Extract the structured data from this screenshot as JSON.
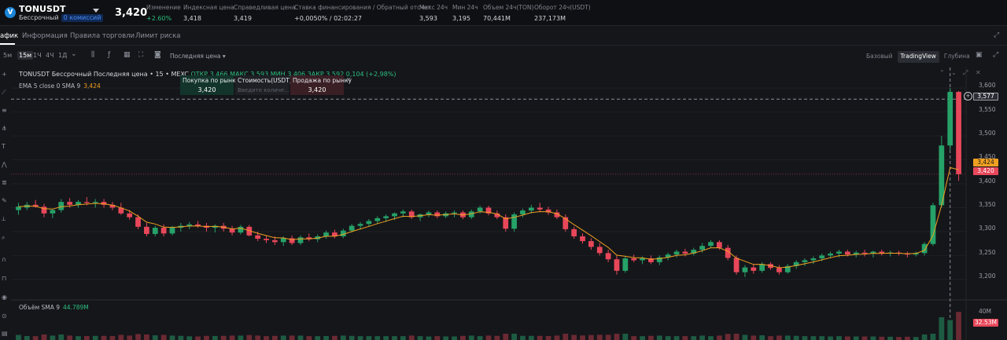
{
  "header": {
    "logo_letter": "V",
    "symbol": "TONUSDT",
    "contract_type": "Бессрочный",
    "fee_badge": "0 комиссий",
    "last_price": "3,420",
    "stats": [
      {
        "label": "Изменение",
        "value": "+2.60%",
        "positive": true
      },
      {
        "label": "Индексная цена",
        "value": "3,418"
      },
      {
        "label": "Справедливая цена",
        "value": "3,419"
      },
      {
        "label": "Ставка финансирования / Обратный отсчет",
        "value": "+0,0050% / 02:02:27"
      },
      {
        "label": "Макс 24ч",
        "value": "3,593"
      },
      {
        "label": "Мин 24ч",
        "value": "3,195"
      },
      {
        "label": "Объем 24ч(TON)",
        "value": "70,441M"
      },
      {
        "label": "Оборот 24ч(USDT)",
        "value": "237,173M"
      }
    ]
  },
  "tabs": [
    {
      "label": "афик",
      "active": true
    },
    {
      "label": "Информация",
      "active": false
    },
    {
      "label": "Правила торговли",
      "active": false
    },
    {
      "label": "Лимит риска",
      "active": false
    }
  ],
  "toolbar": {
    "timeframes": [
      {
        "label": "5м",
        "active": false
      },
      {
        "label": "15м",
        "active": true
      },
      {
        "label": "1Ч",
        "active": false
      },
      {
        "label": "4Ч",
        "active": false
      },
      {
        "label": "1Д",
        "active": false
      }
    ],
    "price_type": "Последняя цена",
    "views": [
      {
        "label": "Базовый",
        "active": false
      },
      {
        "label": "TradingView",
        "active": true
      },
      {
        "label": "Глубина",
        "active": false
      }
    ]
  },
  "legend": {
    "title": "TONUSDT Бессрочный Последняя цена • 15 • MEXC",
    "ohlc": "ОТКР 3,466 МАКС 3,593 МИН 3,406 ЗАКР 3,592 0,104 (+2,98%)",
    "ema_label": "EMA 5 close 0 SMA 9",
    "ema_value": "3,424",
    "volume_label": "Объём SMA 9",
    "volume_value": "44.789M"
  },
  "order_panel": {
    "buy_label": "Покупка по рынку",
    "buy_value": "3,420",
    "cost_label": "Стоимость(USDT)",
    "cost_placeholder": "Введите количе...",
    "sell_label": "Продажа по рынку",
    "sell_value": "3,420"
  },
  "price_axis": {
    "ticks": [
      "3,600",
      "3,550",
      "3,500",
      "3,450",
      "3,400",
      "3,350",
      "3,300",
      "3,250",
      "3,200"
    ],
    "crosshair_price": "3,577",
    "ema_tag": "3,424",
    "last_tag": "3,420",
    "volume_ticks": [
      "40M"
    ],
    "volume_tag": "32.53M"
  },
  "colors": {
    "up": "#26a269",
    "down": "#e8475a",
    "ema": "#f0a020",
    "background": "#15161a"
  },
  "chart_data": {
    "type": "candlestick",
    "symbol": "TONUSDT",
    "interval": "15",
    "ylim": [
      3.18,
      3.62
    ],
    "candles": [
      [
        3.345,
        3.36,
        3.335,
        3.352
      ],
      [
        3.35,
        3.362,
        3.345,
        3.356
      ],
      [
        3.356,
        3.366,
        3.35,
        3.352
      ],
      [
        3.352,
        3.358,
        3.33,
        3.338
      ],
      [
        3.338,
        3.348,
        3.328,
        3.345
      ],
      [
        3.345,
        3.368,
        3.34,
        3.362
      ],
      [
        3.362,
        3.37,
        3.35,
        3.356
      ],
      [
        3.356,
        3.366,
        3.35,
        3.362
      ],
      [
        3.362,
        3.372,
        3.355,
        3.36
      ],
      [
        3.36,
        3.368,
        3.35,
        3.362
      ],
      [
        3.362,
        3.368,
        3.35,
        3.356
      ],
      [
        3.356,
        3.362,
        3.345,
        3.35
      ],
      [
        3.35,
        3.36,
        3.335,
        3.338
      ],
      [
        3.338,
        3.345,
        3.325,
        3.33
      ],
      [
        3.33,
        3.336,
        3.305,
        3.31
      ],
      [
        3.31,
        3.318,
        3.29,
        3.295
      ],
      [
        3.295,
        3.312,
        3.29,
        3.308
      ],
      [
        3.308,
        3.315,
        3.29,
        3.296
      ],
      [
        3.296,
        3.312,
        3.292,
        3.308
      ],
      [
        3.308,
        3.318,
        3.3,
        3.312
      ],
      [
        3.312,
        3.32,
        3.305,
        3.315
      ],
      [
        3.315,
        3.322,
        3.308,
        3.312
      ],
      [
        3.312,
        3.318,
        3.3,
        3.308
      ],
      [
        3.308,
        3.315,
        3.298,
        3.312
      ],
      [
        3.312,
        3.318,
        3.3,
        3.306
      ],
      [
        3.306,
        3.312,
        3.292,
        3.298
      ],
      [
        3.298,
        3.314,
        3.294,
        3.31
      ],
      [
        3.31,
        3.314,
        3.29,
        3.292
      ],
      [
        3.292,
        3.3,
        3.28,
        3.285
      ],
      [
        3.285,
        3.292,
        3.276,
        3.282
      ],
      [
        3.282,
        3.29,
        3.272,
        3.278
      ],
      [
        3.278,
        3.29,
        3.27,
        3.286
      ],
      [
        3.286,
        3.292,
        3.272,
        3.276
      ],
      [
        3.276,
        3.292,
        3.272,
        3.288
      ],
      [
        3.288,
        3.296,
        3.28,
        3.284
      ],
      [
        3.284,
        3.294,
        3.278,
        3.29
      ],
      [
        3.29,
        3.302,
        3.285,
        3.298
      ],
      [
        3.298,
        3.304,
        3.286,
        3.29
      ],
      [
        3.29,
        3.306,
        3.286,
        3.302
      ],
      [
        3.302,
        3.316,
        3.298,
        3.312
      ],
      [
        3.312,
        3.32,
        3.304,
        3.316
      ],
      [
        3.316,
        3.326,
        3.31,
        3.322
      ],
      [
        3.322,
        3.332,
        3.316,
        3.328
      ],
      [
        3.328,
        3.336,
        3.32,
        3.332
      ],
      [
        3.332,
        3.34,
        3.324,
        3.338
      ],
      [
        3.338,
        3.346,
        3.33,
        3.342
      ],
      [
        3.342,
        3.346,
        3.326,
        3.33
      ],
      [
        3.33,
        3.338,
        3.322,
        3.336
      ],
      [
        3.336,
        3.344,
        3.33,
        3.34
      ],
      [
        3.34,
        3.344,
        3.328,
        3.332
      ],
      [
        3.332,
        3.342,
        3.328,
        3.338
      ],
      [
        3.338,
        3.344,
        3.33,
        3.34
      ],
      [
        3.34,
        3.344,
        3.326,
        3.33
      ],
      [
        3.33,
        3.346,
        3.326,
        3.342
      ],
      [
        3.342,
        3.354,
        3.338,
        3.35
      ],
      [
        3.35,
        3.354,
        3.334,
        3.338
      ],
      [
        3.338,
        3.344,
        3.326,
        3.33
      ],
      [
        3.33,
        3.336,
        3.3,
        3.306
      ],
      [
        3.306,
        3.34,
        3.3,
        3.336
      ],
      [
        3.336,
        3.348,
        3.33,
        3.344
      ],
      [
        3.344,
        3.356,
        3.338,
        3.35
      ],
      [
        3.35,
        3.36,
        3.342,
        3.346
      ],
      [
        3.346,
        3.352,
        3.335,
        3.34
      ],
      [
        3.34,
        3.346,
        3.326,
        3.33
      ],
      [
        3.33,
        3.336,
        3.3,
        3.305
      ],
      [
        3.305,
        3.31,
        3.285,
        3.29
      ],
      [
        3.29,
        3.296,
        3.275,
        3.28
      ],
      [
        3.28,
        3.286,
        3.262,
        3.268
      ],
      [
        3.268,
        3.276,
        3.25,
        3.255
      ],
      [
        3.255,
        3.262,
        3.236,
        3.242
      ],
      [
        3.242,
        3.25,
        3.21,
        3.218
      ],
      [
        3.218,
        3.248,
        3.214,
        3.244
      ],
      [
        3.244,
        3.252,
        3.236,
        3.24
      ],
      [
        3.24,
        3.248,
        3.232,
        3.244
      ],
      [
        3.244,
        3.25,
        3.232,
        3.236
      ],
      [
        3.236,
        3.25,
        3.23,
        3.246
      ],
      [
        3.246,
        3.256,
        3.24,
        3.252
      ],
      [
        3.252,
        3.262,
        3.246,
        3.258
      ],
      [
        3.258,
        3.264,
        3.248,
        3.254
      ],
      [
        3.254,
        3.266,
        3.25,
        3.262
      ],
      [
        3.262,
        3.276,
        3.256,
        3.27
      ],
      [
        3.27,
        3.282,
        3.266,
        3.278
      ],
      [
        3.278,
        3.282,
        3.262,
        3.266
      ],
      [
        3.266,
        3.272,
        3.24,
        3.245
      ],
      [
        3.245,
        3.25,
        3.21,
        3.215
      ],
      [
        3.215,
        3.23,
        3.205,
        3.225
      ],
      [
        3.225,
        3.232,
        3.212,
        3.218
      ],
      [
        3.218,
        3.236,
        3.214,
        3.232
      ],
      [
        3.232,
        3.236,
        3.22,
        3.224
      ],
      [
        3.224,
        3.23,
        3.21,
        3.215
      ],
      [
        3.215,
        3.232,
        3.212,
        3.228
      ],
      [
        3.228,
        3.24,
        3.222,
        3.236
      ],
      [
        3.236,
        3.244,
        3.228,
        3.24
      ],
      [
        3.24,
        3.248,
        3.232,
        3.244
      ],
      [
        3.244,
        3.254,
        3.238,
        3.25
      ],
      [
        3.25,
        3.258,
        3.244,
        3.254
      ],
      [
        3.254,
        3.262,
        3.246,
        3.258
      ],
      [
        3.258,
        3.262,
        3.248,
        3.252
      ],
      [
        3.252,
        3.26,
        3.246,
        3.256
      ],
      [
        3.256,
        3.262,
        3.248,
        3.254
      ],
      [
        3.254,
        3.26,
        3.246,
        3.258
      ],
      [
        3.258,
        3.262,
        3.25,
        3.254
      ],
      [
        3.254,
        3.26,
        3.248,
        3.256
      ],
      [
        3.256,
        3.26,
        3.25,
        3.254
      ],
      [
        3.254,
        3.258,
        3.246,
        3.252
      ],
      [
        3.252,
        3.258,
        3.248,
        3.255
      ],
      [
        3.255,
        3.278,
        3.25,
        3.274
      ],
      [
        3.274,
        3.36,
        3.27,
        3.355
      ],
      [
        3.355,
        3.5,
        3.35,
        3.48
      ],
      [
        3.48,
        3.6,
        3.47,
        3.592
      ],
      [
        3.592,
        3.594,
        3.406,
        3.42
      ]
    ],
    "ema": {
      "label": "EMA 5 close 0 SMA 9",
      "last": 3.424
    },
    "volume": {
      "label": "Объём SMA 9",
      "sma": "44.789M",
      "last": "32.53M"
    }
  }
}
